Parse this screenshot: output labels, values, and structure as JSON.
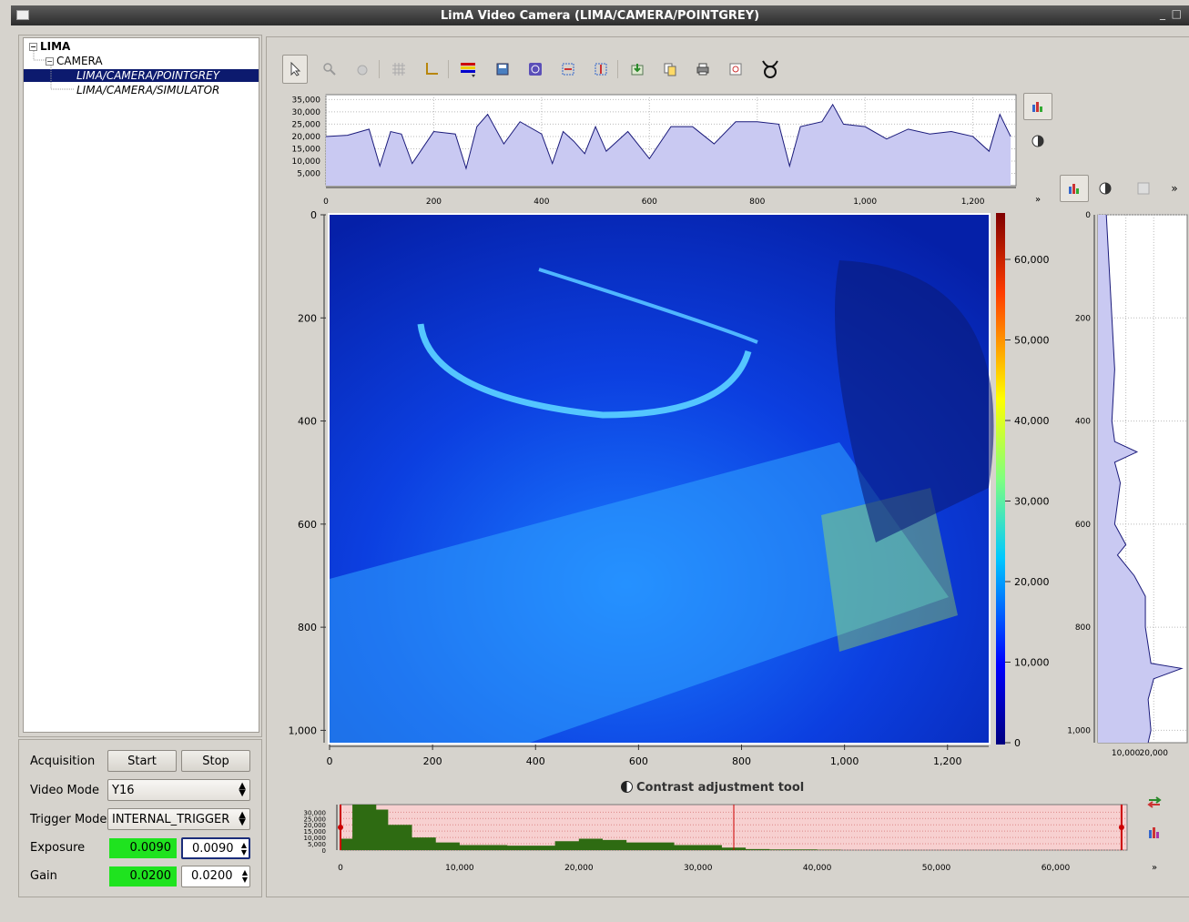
{
  "window": {
    "title": "LimA Video Camera (LIMA/CAMERA/POINTGREY)",
    "minimize": "_",
    "maximize": "□"
  },
  "tree": {
    "root": "LIMA",
    "camera": "CAMERA",
    "items": [
      "LIMA/CAMERA/POINTGREY",
      "LIMA/CAMERA/SIMULATOR"
    ],
    "selected": "LIMA/CAMERA/POINTGREY"
  },
  "controls": {
    "acquisition_label": "Acquisition",
    "start": "Start",
    "stop": "Stop",
    "video_mode_label": "Video Mode",
    "video_mode_value": "Y16",
    "trigger_mode_label": "Trigger Mode",
    "trigger_mode_value": "INTERNAL_TRIGGER",
    "exposure_label": "Exposure",
    "exposure_readback": "0.0090",
    "exposure_setpoint": "0.0090",
    "gain_label": "Gain",
    "gain_readback": "0.0200",
    "gain_setpoint": "0.0200"
  },
  "toolbar_icons": [
    "select-arrow-icon",
    "zoom-icon",
    "pan-icon",
    "grid-icon",
    "axes-icon",
    "colormap-icon",
    "save-image-icon",
    "info-icon",
    "roi-icon",
    "mask-icon",
    "export-icon",
    "copy-icon",
    "print-icon",
    "aspect-icon",
    "taurus-icon"
  ],
  "contrast_tool": {
    "title": "Contrast adjustment tool"
  },
  "colors": {
    "curve_fill": "#c9c9f2",
    "curve_line": "#1a1a7a",
    "histogram": "#2e6b12",
    "histogram_bg": "#f7d0d0",
    "selection": "#0c1a6e",
    "green_readback": "#1fe31f"
  },
  "chart_data": [
    {
      "type": "area",
      "name": "horizontal-profile",
      "x_ticks": [
        "0",
        "200",
        "400",
        "600",
        "800",
        "1,000",
        "1,200"
      ],
      "y_ticks": [
        "35,000",
        "30,000",
        "25,000",
        "20,000",
        "15,000",
        "10,000",
        "5,000"
      ],
      "xlim": [
        0,
        1280
      ],
      "ylim": [
        0,
        37000
      ],
      "x": [
        0,
        40,
        80,
        100,
        120,
        140,
        160,
        200,
        240,
        260,
        280,
        300,
        330,
        360,
        400,
        420,
        440,
        460,
        480,
        500,
        520,
        560,
        600,
        640,
        680,
        720,
        760,
        800,
        840,
        860,
        880,
        920,
        940,
        960,
        1000,
        1040,
        1080,
        1120,
        1160,
        1200,
        1230,
        1250,
        1270
      ],
      "y": [
        20000,
        20500,
        23000,
        8000,
        22000,
        21000,
        9000,
        22000,
        21000,
        7000,
        24000,
        29000,
        17000,
        26000,
        21000,
        9000,
        22000,
        18000,
        13000,
        24000,
        14000,
        22000,
        11000,
        24000,
        24000,
        17000,
        26000,
        26000,
        25000,
        8000,
        24000,
        26000,
        33000,
        25000,
        24000,
        19000,
        23000,
        21000,
        22000,
        20000,
        14000,
        29000,
        20000
      ]
    },
    {
      "type": "heatmap",
      "name": "camera-image",
      "x_ticks": [
        "0",
        "200",
        "400",
        "600",
        "800",
        "1,000",
        "1,200"
      ],
      "y_ticks": [
        "0",
        "200",
        "400",
        "600",
        "800",
        "1,000"
      ],
      "xlim": [
        0,
        1280
      ],
      "ylim": [
        0,
        1024
      ],
      "colorbar_ticks": [
        "0",
        "10,000",
        "20,000",
        "30,000",
        "40,000",
        "50,000",
        "60,000"
      ],
      "colorbar_range": [
        0,
        65535
      ]
    },
    {
      "type": "area",
      "name": "vertical-profile",
      "y_ticks": [
        "0",
        "200",
        "400",
        "600",
        "800",
        "1,000"
      ],
      "x_ticks": [
        "10,000",
        "20,000"
      ],
      "ylim": [
        0,
        1024
      ],
      "y": [
        0,
        100,
        200,
        300,
        400,
        440,
        460,
        480,
        520,
        600,
        640,
        660,
        700,
        740,
        800,
        870,
        880,
        900,
        940,
        1000,
        1024
      ],
      "x": [
        3000,
        4000,
        5000,
        6000,
        5000,
        6000,
        14000,
        6000,
        8000,
        6000,
        10000,
        7000,
        13000,
        17000,
        17000,
        19000,
        30000,
        20000,
        18000,
        19000,
        18000
      ]
    },
    {
      "type": "bar",
      "name": "contrast-histogram",
      "x_ticks": [
        "0",
        "10,000",
        "20,000",
        "30,000",
        "40,000",
        "50,000",
        "60,000"
      ],
      "y_ticks": [
        "30,000",
        "25,000",
        "20,000",
        "15,000",
        "10,000",
        "5,000",
        "0"
      ],
      "xlim": [
        0,
        66000
      ],
      "x": [
        0,
        1000,
        2000,
        3000,
        4000,
        6000,
        8000,
        10000,
        14000,
        18000,
        20000,
        22000,
        24000,
        28000,
        32000,
        34000,
        36000,
        40000,
        42000
      ],
      "values": [
        9000,
        36000,
        36000,
        32000,
        20000,
        10000,
        6000,
        4000,
        3500,
        7000,
        9000,
        8000,
        6000,
        4000,
        2000,
        800,
        500,
        300,
        100
      ]
    }
  ]
}
